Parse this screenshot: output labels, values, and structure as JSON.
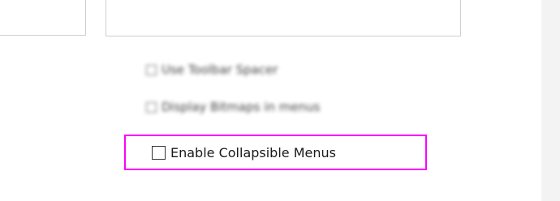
{
  "options": {
    "blurred_option_1_label": "Use Toolbar Spacer",
    "blurred_option_2_label": "Display Bitmaps in menus",
    "collapsible_label": "Enable Collapsible Menus",
    "collapsible_checked": false
  },
  "colors": {
    "highlight": "#ff00ff",
    "gutter": "#f3f3f3",
    "border": "#cfcfcf"
  }
}
